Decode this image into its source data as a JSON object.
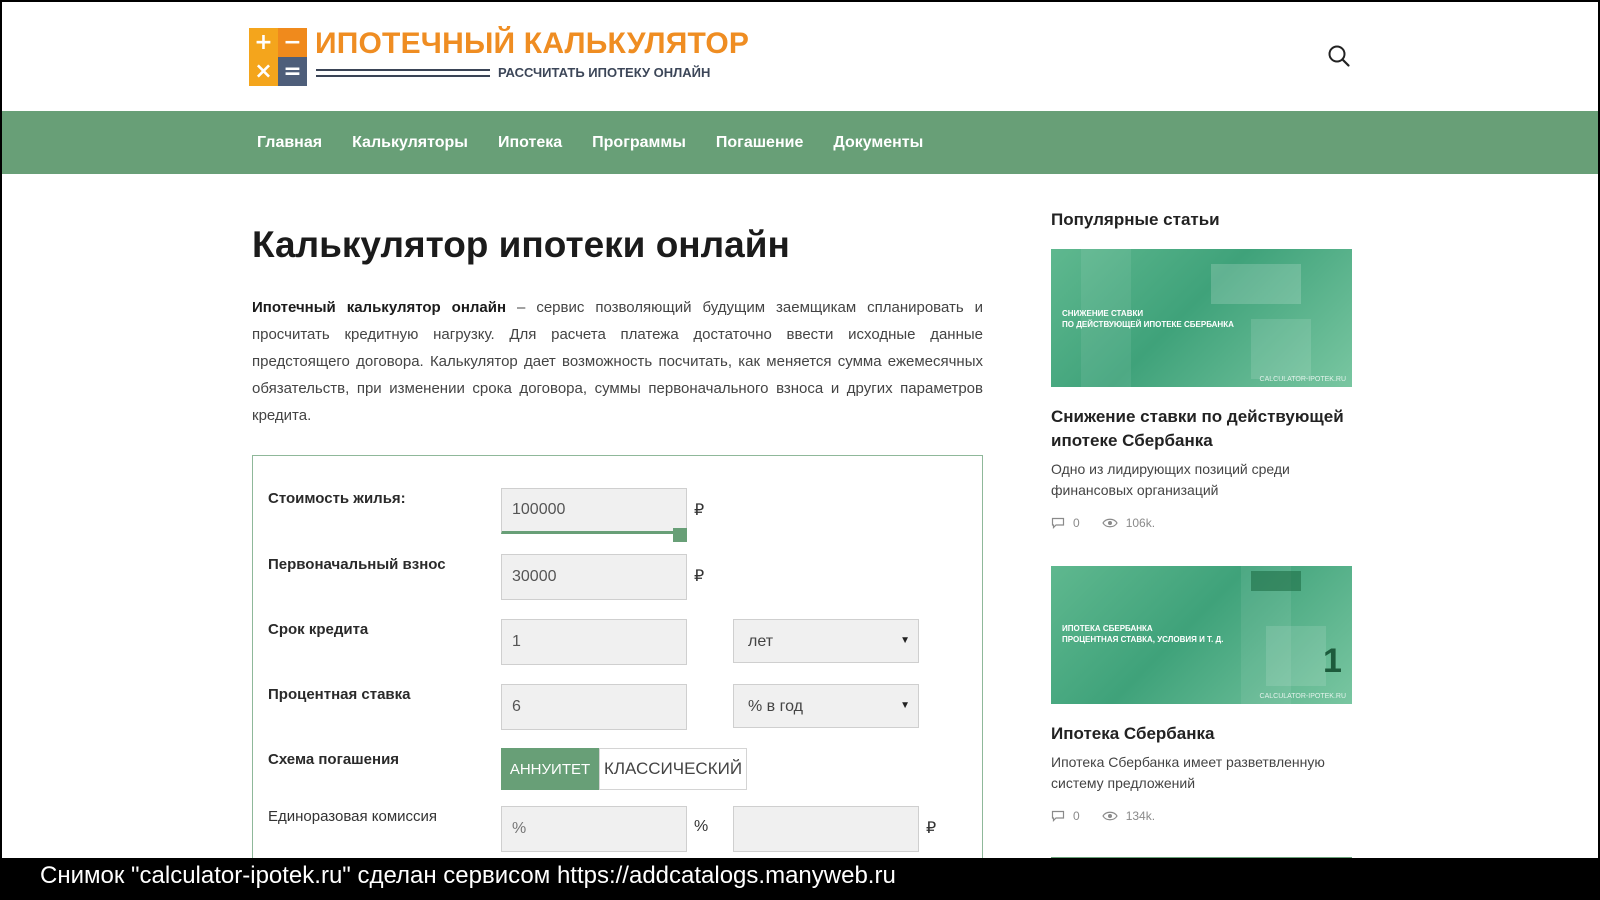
{
  "header": {
    "logo_tiles": [
      "+",
      "−",
      "×",
      "="
    ],
    "logo_title": "ИПОТЕЧНЫЙ КАЛЬКУЛЯТОР",
    "logo_subtitle": "РАССЧИТАТЬ ИПОТЕКУ ОНЛАЙН",
    "search_icon": "search-icon"
  },
  "nav": {
    "items": [
      "Главная",
      "Калькуляторы",
      "Ипотека",
      "Программы",
      "Погашение",
      "Документы"
    ]
  },
  "main": {
    "title": "Калькулятор ипотеки онлайн",
    "intro_bold": "Ипотечный калькулятор онлайн",
    "intro_rest": " – сервис позволяющий будущим заемщикам спланировать и просчитать кредитную нагрузку. Для расчета платежа достаточно ввести исходные данные предстоящего договора. Калькулятор дает возможность посчитать, как меняется сумма ежемесячных обязательств, при изменении срока договора, суммы первоначального взноса и других параметров кредита."
  },
  "calculator": {
    "price_label": "Стоимость жилья:",
    "price_value": "100000",
    "price_slider_percent": 100,
    "down_label": "Первоначальный взнос",
    "down_value": "30000",
    "term_label": "Срок кредита",
    "term_value": "1",
    "term_unit": "лет",
    "rate_label": "Процентная ставка",
    "rate_value": "6",
    "rate_unit": "% в год",
    "scheme_label": "Схема погашения",
    "scheme_options": [
      "АННУИТЕТ",
      "КЛАССИЧЕСКИЙ"
    ],
    "scheme_selected": "АННУИТЕТ",
    "fee_label": "Единоразовая комиссия",
    "fee_percent_placeholder": "%",
    "fee_percent_unit": "%",
    "fee_amount_value": "",
    "currency": "₽",
    "select_arrow": "▼"
  },
  "sidebar": {
    "title": "Популярные статьи",
    "articles": [
      {
        "image_caption": "СНИЖЕНИЕ СТАВКИ\nПО ДЕЙСТВУЮЩЕЙ ИПОТЕКЕ СБЕРБАНКА",
        "image_watermark": "CALCULATOR-IPOTEK.RU",
        "title": "Снижение ставки по действующей ипотеке Сбербанка",
        "description": "Одно из лидирующих позиций среди финансовых организаций",
        "comments": "0",
        "views": "106k."
      },
      {
        "image_caption": "ИПОТЕКА СБЕРБАНКА\nПРОЦЕНТНАЯ СТАВКА, УСЛОВИЯ И Т. Д.",
        "image_watermark": "CALCULATOR-IPOTEK.RU",
        "image_number": "1",
        "title": "Ипотека Сбербанка",
        "description": "Ипотека Сбербанка имеет разветвленную систему предложений",
        "comments": "0",
        "views": "134k."
      }
    ]
  },
  "caption": "Снимок \"calculator-ipotek.ru\" сделан сервисом https://addcatalogs.manyweb.ru",
  "colors": {
    "accent_green": "#689f77",
    "logo_orange": "#ef8d22",
    "logo_navy": "#3c4658"
  }
}
